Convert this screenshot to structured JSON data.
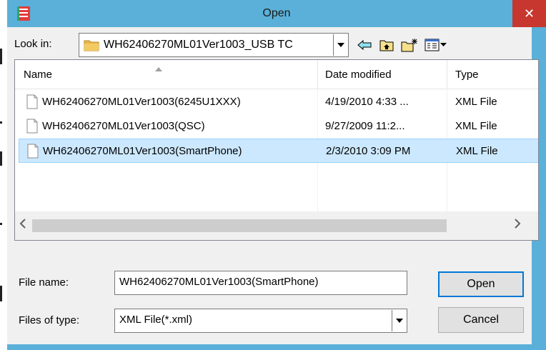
{
  "window": {
    "title": "Open",
    "close_glyph": "✕"
  },
  "lookin": {
    "label": "Look in:",
    "value": "WH62406270ML01Ver1003_USB TC"
  },
  "toolbar": {
    "icons": [
      "back-arrow-icon",
      "up-folder-icon",
      "new-folder-icon",
      "view-menu-icon"
    ]
  },
  "list": {
    "columns": [
      "Name",
      "Date modified",
      "Type"
    ],
    "rows": [
      {
        "name": "WH62406270ML01Ver1003(6245U1XXX)",
        "date": "4/19/2010 4:33 ...",
        "type": "XML File",
        "selected": false
      },
      {
        "name": "WH62406270ML01Ver1003(QSC)",
        "date": "9/27/2009 11:2...",
        "type": "XML File",
        "selected": false
      },
      {
        "name": "WH62406270ML01Ver1003(SmartPhone)",
        "date": "2/3/2010 3:09 PM",
        "type": "XML File",
        "selected": true
      }
    ]
  },
  "filename": {
    "label": "File name:",
    "value": "WH62406270ML01Ver1003(SmartPhone)"
  },
  "filetype": {
    "label": "Files of type:",
    "value": "XML File(*.xml)"
  },
  "buttons": {
    "open": "Open",
    "cancel": "Cancel"
  },
  "colors": {
    "titlebar": "#5ab0d8",
    "close": "#c7372f",
    "selection": "#cce8ff"
  }
}
